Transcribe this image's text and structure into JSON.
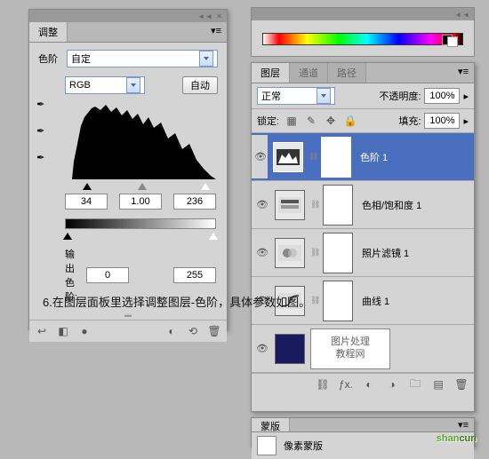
{
  "adjustments": {
    "tab": "调整",
    "type_label": "色阶",
    "preset": "自定",
    "channel": "RGB",
    "auto_btn": "自动",
    "input_levels": {
      "black": "34",
      "mid": "1.00",
      "white": "236"
    },
    "output_label": "输出色阶:",
    "output_levels": {
      "black": "0",
      "white": "255"
    }
  },
  "layers": {
    "tabs": {
      "layers": "图层",
      "channels": "通道",
      "paths": "路径"
    },
    "blend_mode": "正常",
    "opacity_label": "不透明度:",
    "opacity_value": "100%",
    "lock_label": "锁定:",
    "fill_label": "填充:",
    "fill_value": "100%",
    "items": [
      {
        "name": "色阶 1"
      },
      {
        "name": "色相/饱和度 1"
      },
      {
        "name": "照片滤镜 1"
      },
      {
        "name": "曲线 1"
      },
      {
        "name": "图片处理",
        "sub": "教程网"
      }
    ]
  },
  "masks": {
    "tab": "蒙版",
    "label": "像素蒙版"
  },
  "caption": "6.在图层面板里选择调整图层-色阶，具体参数如图。",
  "watermark": {
    "a": "shan",
    "b": "cun"
  }
}
